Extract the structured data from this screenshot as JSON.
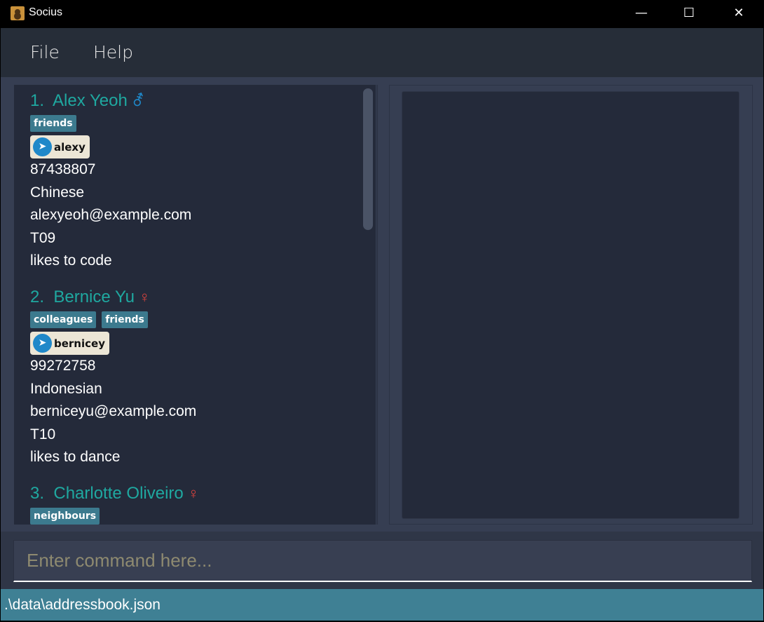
{
  "window": {
    "title": "Socius",
    "minimize": "—",
    "maximize": "☐",
    "close": "✕"
  },
  "menu": {
    "file": "File",
    "help": "Help"
  },
  "persons": [
    {
      "index": "1.",
      "name": "Alex Yeoh",
      "gender": "male",
      "gender_symbol": "⚦",
      "gender_color": "#1f88c9",
      "tags": [
        "friends"
      ],
      "telegram": "alexy",
      "phone": "87438807",
      "nationality": "Chinese",
      "email": "alexyeoh@example.com",
      "tutorial": "T09",
      "remark": "likes to code"
    },
    {
      "index": "2.",
      "name": "Bernice Yu",
      "gender": "female",
      "gender_symbol": "♀",
      "gender_color": "#e0443e",
      "tags": [
        "colleagues",
        "friends"
      ],
      "telegram": "bernicey",
      "phone": "99272758",
      "nationality": "Indonesian",
      "email": "berniceyu@example.com",
      "tutorial": "T10",
      "remark": "likes to dance"
    },
    {
      "index": "3.",
      "name": "Charlotte Oliveiro",
      "gender": "female",
      "gender_symbol": "♀",
      "gender_color": "#e0443e",
      "tags": [
        "neighbours"
      ]
    }
  ],
  "command": {
    "placeholder": "Enter command here...",
    "value": ""
  },
  "status": {
    "path": ".\\data\\addressbook.json"
  }
}
